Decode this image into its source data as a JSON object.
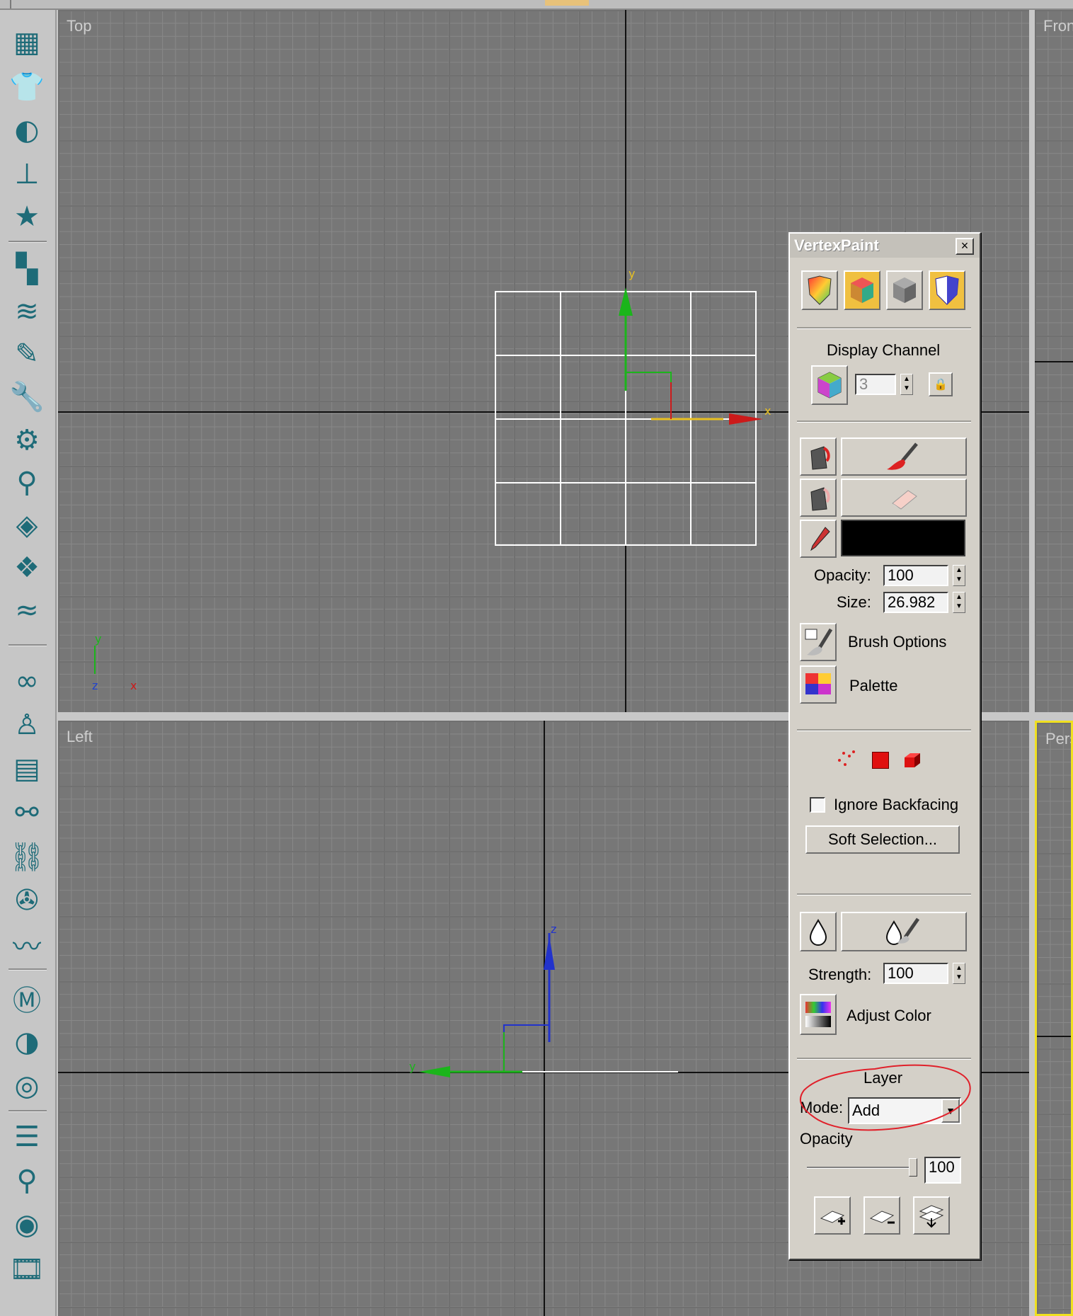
{
  "toolbar": {
    "icons": [
      "boxes-icon",
      "tshirt-icon",
      "sphere-icon",
      "pin-icon",
      "star-figure-icon",
      "checker-icon",
      "layers-icon",
      "pencil-icon",
      "wrench-icon",
      "gear-icon",
      "weathervane-icon",
      "fish-icon",
      "cloth-icon",
      "waves-icon",
      "knot-icon",
      "biped-icon",
      "panel-icon",
      "link-icon",
      "bone-icon",
      "wheel-icon",
      "rope-icon",
      "material-tshirt-icon",
      "material-sphere-icon",
      "material-map-icon",
      "list-icon",
      "magnifier-icon",
      "render-icon",
      "film-render-icon"
    ]
  },
  "viewports": {
    "top": {
      "label": "Top"
    },
    "front": {
      "label": "Fron"
    },
    "left": {
      "label": "Left"
    },
    "perspective": {
      "label": "Pers"
    }
  },
  "axes": {
    "x": "x",
    "y": "y",
    "z": "z"
  },
  "panel": {
    "title": "VertexPaint",
    "close": "×",
    "display_channel": {
      "label": "Display Channel",
      "value": "3",
      "lock": "🔒"
    },
    "opacity": {
      "label": "Opacity:",
      "value": "100"
    },
    "size": {
      "label": "Size:",
      "value": "26.982"
    },
    "brush_options": "Brush Options",
    "palette": "Palette",
    "ignore_backfacing": "Ignore Backfacing",
    "soft_selection": "Soft Selection...",
    "strength": {
      "label": "Strength:",
      "value": "100"
    },
    "adjust_color": "Adjust Color",
    "layer": {
      "title": "Layer",
      "mode_label": "Mode:",
      "mode_value": "Add",
      "opacity_label": "Opacity",
      "opacity_value": "100"
    }
  },
  "colors": {
    "paint_color": "#000000",
    "viewport_bg": "#777777",
    "annotation": "#e0202a",
    "active_viewport_border": "#f0e020"
  }
}
